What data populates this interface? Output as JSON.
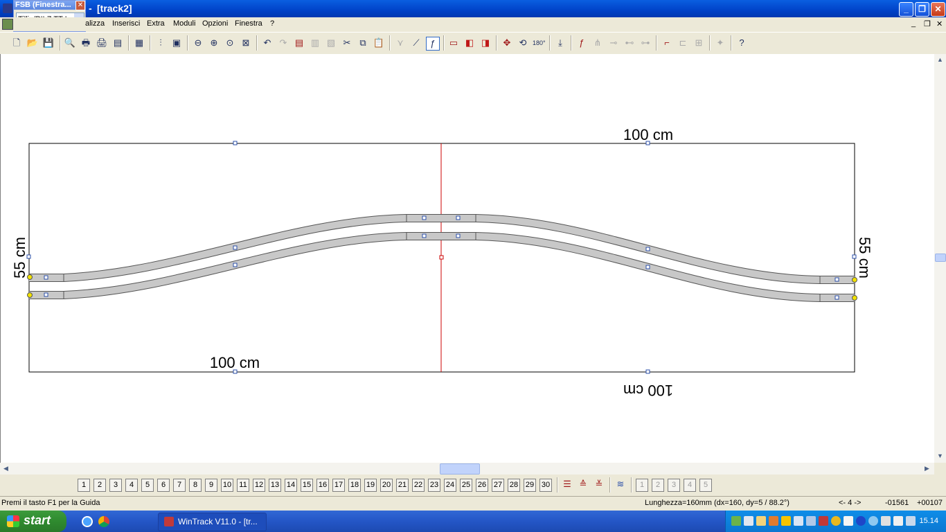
{
  "window": {
    "title": "[track2]",
    "title_prefix": "- "
  },
  "fsb_popup": {
    "caption": "FSB (Finestra...",
    "selected": "Tillig/PILZ  TT I"
  },
  "menu": {
    "items": [
      "alizza",
      "Inserisci",
      "Extra",
      "Moduli",
      "Opzioni",
      "Finestra",
      "?"
    ]
  },
  "drawing": {
    "dim_top": "100 cm",
    "dim_bottom_left": "100 cm",
    "dim_bottom_right": "100 cm",
    "dim_left": "55 cm",
    "dim_right": "55 cm"
  },
  "pages": {
    "numbers": [
      "1",
      "2",
      "3",
      "4",
      "5",
      "6",
      "7",
      "8",
      "9",
      "10",
      "11",
      "12",
      "13",
      "14",
      "15",
      "16",
      "17",
      "18",
      "19",
      "20",
      "21",
      "22",
      "23",
      "24",
      "25",
      "26",
      "27",
      "28",
      "29",
      "30"
    ],
    "layers": [
      "1",
      "2",
      "3",
      "4",
      "5"
    ]
  },
  "status": {
    "help": "Premi il tasto F1 per la Guida",
    "length": "Lunghezza=160mm (dx=160, dy=5 / 88.2°)",
    "page": "<- 4 ->",
    "x": "-01561",
    "y": "+00107"
  },
  "taskbar": {
    "start": "start",
    "task": "WinTrack  V11.0 - [tr...",
    "clock": "15.14"
  },
  "colors": {
    "xp_blue": "#0042c8",
    "track_fill": "#c8c8c8",
    "ruler_red": "#cc0000",
    "handle_blue": "#2b4fa8",
    "endpoint_yellow": "#f2e200"
  }
}
